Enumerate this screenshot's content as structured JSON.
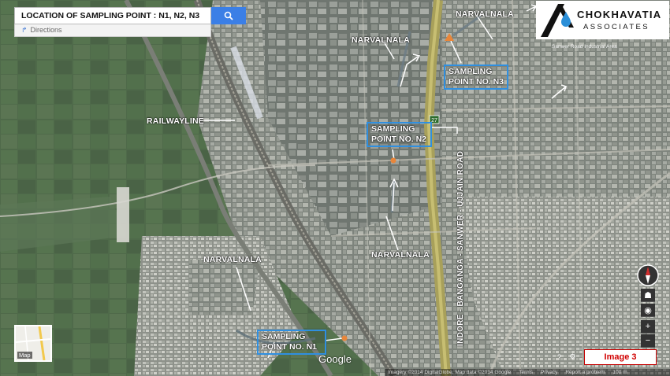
{
  "search": {
    "query": "LOCATION OF SAMPLING POINT : N1, N2, N3",
    "directions_label": "Directions"
  },
  "logo": {
    "name": "CHOKHAVATIA",
    "subtitle": "ASSOCIATES"
  },
  "map_labels": {
    "narval_top": "NARVALNALA",
    "narval_top_right": "NARVALNALA",
    "railway": "RAILWAYLINE",
    "narval_center": "NARVALNALA",
    "narval_bottom_left": "NARVALNALA",
    "road": "INDORE - BANGANGA - SANWER - UJJAIN ROAD",
    "area_label": "Sanwer Road Industrial Area",
    "road_shield": "27"
  },
  "sampling_points": {
    "n1": {
      "line1": "SAMPLING",
      "line2": "POINT NO. N1"
    },
    "n2": {
      "line1": "SAMPLING",
      "line2": "POINT NO. N2"
    },
    "n3": {
      "line1": "SAMPLING",
      "line2": "POINT NO. N3"
    }
  },
  "map_thumb_label": "Map",
  "google_label": "Google",
  "footer": {
    "imagery": "Imagery ©2014 DigitalGlobe, Map data ©2014 Google",
    "terms": "Terms",
    "privacy": "Privacy",
    "report": "Report a problem",
    "scale": "100 m"
  },
  "image_label": "Image 3",
  "controls": {
    "zoom_in": "+",
    "zoom_out": "−",
    "help": "?"
  },
  "colors": {
    "box_border": "#2f8fe0",
    "search_button": "#3b7fe6",
    "image_label": "#d10000",
    "marker": "#e8863a"
  }
}
